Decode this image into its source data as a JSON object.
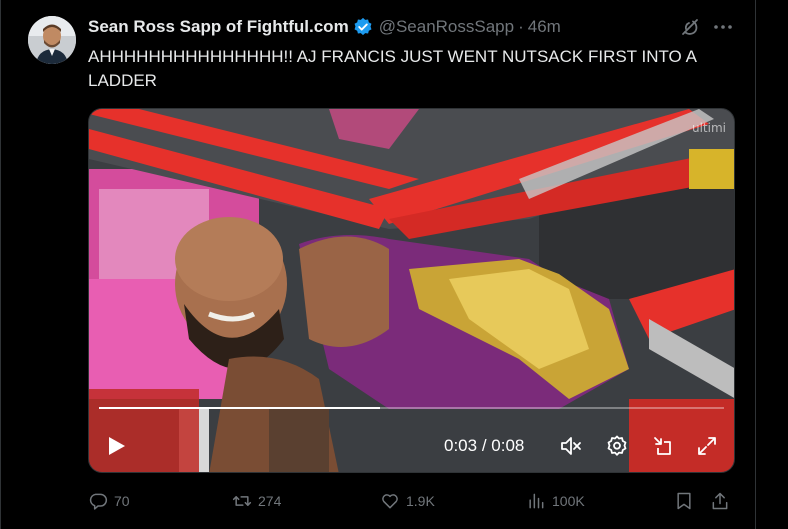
{
  "author": {
    "display_name": "Sean Ross Sapp of Fightful.com",
    "handle": "@SeanRossSapp",
    "separator": "·",
    "time": "46m",
    "verified_color": "#1d9bf0"
  },
  "tweet": {
    "text": "AHHHHHHHHHHHHHHH!! AJ FRANCIS JUST WENT NUTSACK FIRST INTO A LADDER"
  },
  "video": {
    "watermark": "ultimi",
    "current_time": "0:03",
    "separator": " / ",
    "duration": "0:08",
    "progress_fraction": 0.45
  },
  "actions": {
    "replies": "70",
    "reposts": "274",
    "likes": "1.9K",
    "views": "100K"
  },
  "icons": [
    "grok-icon",
    "more-icon",
    "play-icon",
    "volume-icon",
    "settings-icon",
    "minimize-icon",
    "fullscreen-icon",
    "reply-icon",
    "repost-icon",
    "like-icon",
    "views-icon",
    "bookmark-icon",
    "share-icon"
  ],
  "colors": {
    "background": "#000000",
    "text": "#e7e9ea",
    "muted": "#71767b",
    "accent": "#1d9bf0"
  }
}
